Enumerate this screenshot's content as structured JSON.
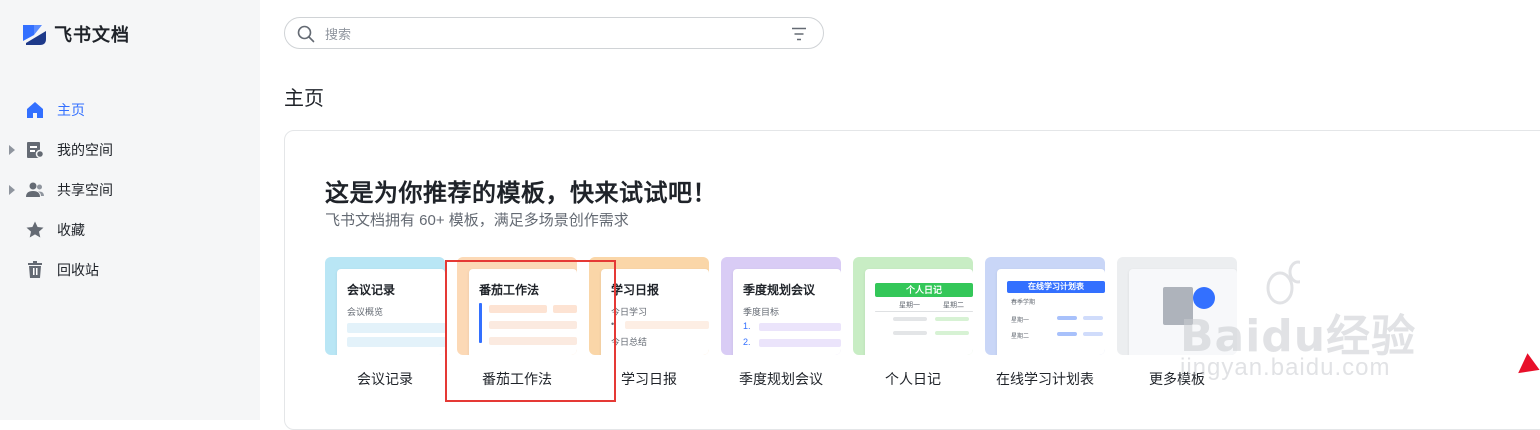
{
  "app": {
    "name": "飞书文档",
    "accent": "#3370ff"
  },
  "sidebar": {
    "items": [
      {
        "label": "主页",
        "icon": "home-icon",
        "active": true,
        "expandable": false
      },
      {
        "label": "我的空间",
        "icon": "my-space-icon",
        "active": false,
        "expandable": true
      },
      {
        "label": "共享空间",
        "icon": "shared-space-icon",
        "active": false,
        "expandable": true
      },
      {
        "label": "收藏",
        "icon": "star-icon",
        "active": false,
        "expandable": false
      },
      {
        "label": "回收站",
        "icon": "trash-icon",
        "active": false,
        "expandable": false
      }
    ]
  },
  "search": {
    "placeholder": "搜索",
    "value": ""
  },
  "main": {
    "title": "主页",
    "recommend": {
      "heading": "这是为你推荐的模板，快来试试吧！",
      "subheading": "飞书文档拥有 60+ 模板，满足多场景创作需求",
      "templates": [
        {
          "label": "会议记录",
          "thumb_title": "会议记录",
          "thumb_lines": [
            "会议概览"
          ],
          "color": "#b9e6f5"
        },
        {
          "label": "番茄工作法",
          "thumb_title": "番茄工作法",
          "thumb_lines": [],
          "color": "#fcd9b6"
        },
        {
          "label": "学习日报",
          "thumb_title": "学习日报",
          "thumb_lines": [
            "今日学习",
            "•",
            "今日总结"
          ],
          "color": "#fad6a8"
        },
        {
          "label": "季度规划会议",
          "thumb_title": "季度规划会议",
          "thumb_lines": [
            "季度目标",
            "1.",
            "2."
          ],
          "color": "#d9ccf5"
        },
        {
          "label": "个人日记",
          "thumb_title": "个人日记",
          "thumb_lines": [
            "星期一",
            "星期二"
          ],
          "color": "#c8edc4"
        },
        {
          "label": "在线学习计划表",
          "thumb_title": "在线学习计划表",
          "thumb_lines": [
            "春季学期",
            "星期一",
            "星期二"
          ],
          "color": "#c9d6f7"
        },
        {
          "label": "更多模板",
          "thumb_title": "",
          "thumb_lines": [],
          "color": "#eceef0"
        }
      ]
    }
  },
  "watermark": {
    "text": "Baidu经验",
    "url": "jingyan.baidu.com"
  }
}
